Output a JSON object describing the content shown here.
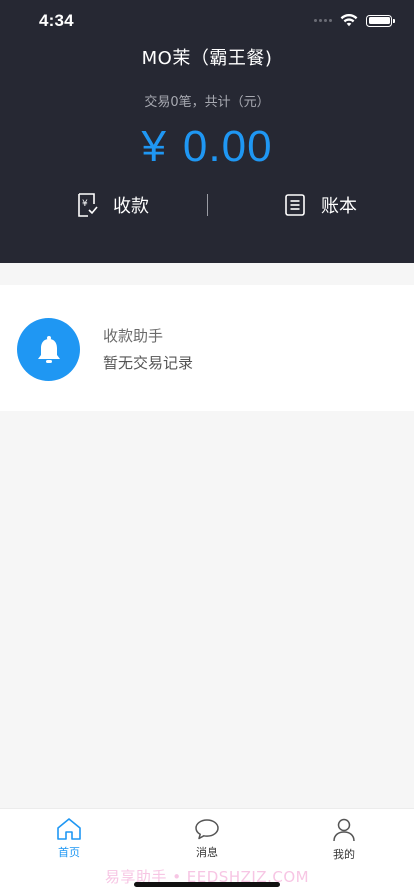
{
  "status_bar": {
    "time": "4:34"
  },
  "header": {
    "store_name": "MO茉（霸王餐)",
    "summary": "交易0笔，共计（元）",
    "currency_symbol": "¥",
    "amount": "0.00",
    "actions": [
      {
        "label": "收款",
        "icon": "receipt-yen-icon"
      },
      {
        "label": "账本",
        "icon": "ledger-icon"
      }
    ]
  },
  "notice_card": {
    "icon": "bell-icon",
    "title": "收款助手",
    "subtitle": "暂无交易记录"
  },
  "tabbar": {
    "items": [
      {
        "label": "首页",
        "icon": "home-icon",
        "active": true
      },
      {
        "label": "消息",
        "icon": "chat-bubble-icon",
        "active": false
      },
      {
        "label": "我的",
        "icon": "person-icon",
        "active": false
      }
    ]
  },
  "watermark": "易享助手 • EEDSHZJZ.COM",
  "colors": {
    "header_bg": "#262833",
    "accent": "#1f97f3",
    "page_bg": "#f6f6f6"
  }
}
